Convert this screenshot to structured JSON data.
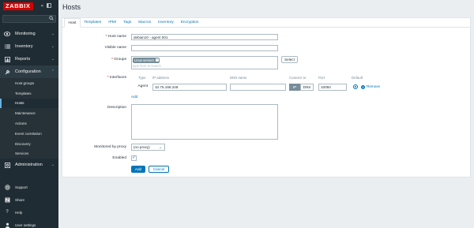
{
  "app": {
    "logo_text": "ZABBIX"
  },
  "sidebar": {
    "collapse_icon": "collapse-icon",
    "expand_icon": "popout-icon",
    "search_placeholder": "",
    "menu": [
      {
        "label": "Monitoring",
        "icon": "eye-icon"
      },
      {
        "label": "Inventory",
        "icon": "list-icon"
      },
      {
        "label": "Reports",
        "icon": "bar-chart-icon"
      },
      {
        "label": "Configuration",
        "icon": "wrench-icon"
      }
    ],
    "submenu": [
      {
        "label": "Host groups"
      },
      {
        "label": "Templates"
      },
      {
        "label": "Hosts"
      },
      {
        "label": "Maintenance"
      },
      {
        "label": "Actions"
      },
      {
        "label": "Event correlation"
      },
      {
        "label": "Discovery"
      },
      {
        "label": "Services"
      }
    ],
    "admin": {
      "label": "Administration",
      "icon": "gear-icon"
    },
    "bottom": [
      {
        "label": "Support",
        "icon": "lifebuoy-icon"
      },
      {
        "label": "Share",
        "icon": "share-icon"
      },
      {
        "label": "Help",
        "icon": "question-icon"
      },
      {
        "label": "User settings",
        "icon": "user-icon"
      }
    ]
  },
  "page": {
    "title": "Hosts",
    "tabs": [
      {
        "label": "Host"
      },
      {
        "label": "Templates"
      },
      {
        "label": "IPMI"
      },
      {
        "label": "Tags"
      },
      {
        "label": "Macros"
      },
      {
        "label": "Inventory"
      },
      {
        "label": "Encryption"
      }
    ]
  },
  "form": {
    "host_name": {
      "label": "Host name",
      "value": "debian10 - agent 001"
    },
    "visible_name": {
      "label": "Visible name",
      "value": ""
    },
    "groups": {
      "label": "Groups",
      "chip": "Linux servers",
      "placeholder": "type here to search",
      "select_button": "Select"
    },
    "interfaces": {
      "label": "Interfaces",
      "headers": {
        "type": "Type",
        "ip": "IP address",
        "dns": "DNS name",
        "connect": "Connect to",
        "port": "Port",
        "default": "Default"
      },
      "row": {
        "type": "Agent",
        "ip": "10.75.166.248",
        "dns": "",
        "ip_toggle": "IP",
        "dns_toggle": "DNS",
        "port": "10050",
        "remove": "Remove"
      },
      "add_link": "Add"
    },
    "description": {
      "label": "Description",
      "value": ""
    },
    "proxy": {
      "label": "Monitored by proxy",
      "value": "(no proxy)"
    },
    "enabled": {
      "label": "Enabled",
      "checked": true
    },
    "buttons": {
      "add": "Add",
      "cancel": "Cancel"
    }
  },
  "colors": {
    "sidebar": "#1f2c33",
    "accent": "#0275b8",
    "logo": "#d40000",
    "required": "#d40000",
    "background": "#ebeef0"
  }
}
